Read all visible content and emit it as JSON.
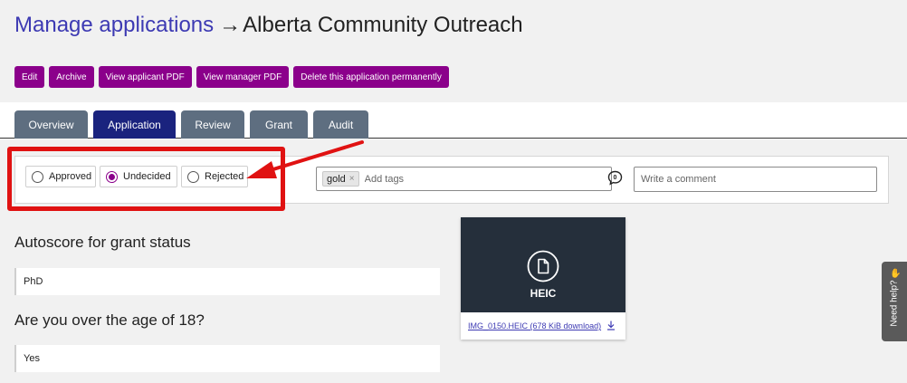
{
  "header": {
    "breadcrumb_link": "Manage applications",
    "arrow": "→",
    "title": "Alberta Community Outreach"
  },
  "actions": [
    "Edit",
    "Archive",
    "View applicant PDF",
    "View manager PDF",
    "Delete this application permanently"
  ],
  "tabs": [
    {
      "label": "Overview",
      "active": false
    },
    {
      "label": "Application",
      "active": true
    },
    {
      "label": "Review",
      "active": false
    },
    {
      "label": "Grant",
      "active": false
    },
    {
      "label": "Audit",
      "active": false
    }
  ],
  "decision": {
    "options": [
      "Approved",
      "Undecided",
      "Rejected"
    ],
    "selected": "Undecided"
  },
  "tags": {
    "items": [
      "gold"
    ],
    "remove_symbol": "×",
    "placeholder": "Add tags"
  },
  "comment": {
    "placeholder": "Write a comment",
    "icon": "comment-icon"
  },
  "questions": [
    {
      "label": "Autoscore for grant status",
      "answer": "PhD"
    },
    {
      "label": "Are you over the age of 18?",
      "answer": "Yes"
    }
  ],
  "file": {
    "type": "HEIC",
    "link_text": "IMG_0150.HEIC (678 KiB download)",
    "icon": "document-icon"
  },
  "help": {
    "label": "Need help?",
    "emoji": "wave-icon"
  },
  "colors": {
    "accent_purple": "#8b008b",
    "tab_active": "#1a237e",
    "tab_inactive": "#5e6e80",
    "link_blue": "#3d3ab3",
    "annotation_red": "#e01212",
    "file_preview_bg": "#252f3b"
  }
}
